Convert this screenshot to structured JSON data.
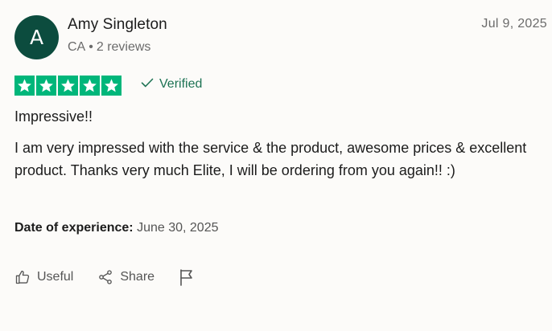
{
  "reviewer": {
    "initial": "A",
    "name": "Amy Singleton",
    "country": "CA",
    "separator": "•",
    "review_count": "2 reviews"
  },
  "review": {
    "date": "Jul 9, 2025",
    "rating": 5,
    "verified_label": "Verified",
    "title": "Impressive!!",
    "body": "I am very impressed with the service & the product, awesome prices & excellent product. Thanks very much Elite, I will be ordering from you again!! :)",
    "experience_label": "Date of experience:",
    "experience_date": "June 30, 2025"
  },
  "actions": {
    "useful_label": "Useful",
    "share_label": "Share"
  },
  "colors": {
    "avatar_bg": "#0c4c3e",
    "star_green": "#00b67a",
    "verified_green": "#1d7354"
  },
  "icons": [
    "star-icon",
    "checkmark-icon",
    "thumbs-up-icon",
    "share-icon",
    "flag-icon"
  ]
}
